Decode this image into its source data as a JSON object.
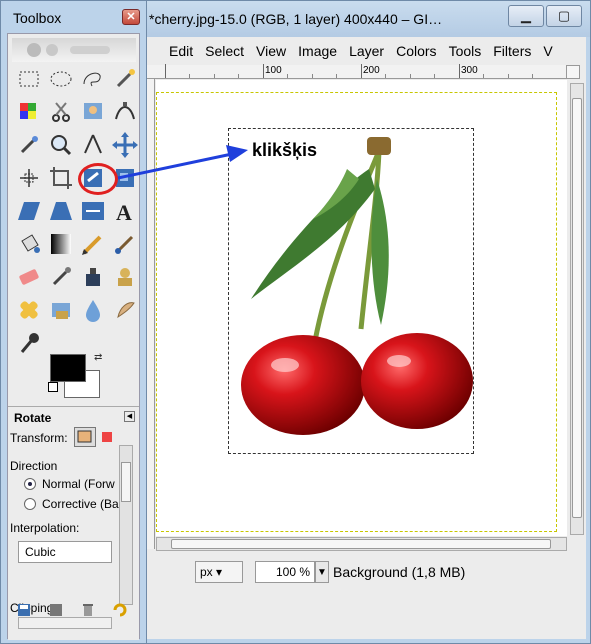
{
  "image_window": {
    "title": "*cherry.jpg-15.0 (RGB, 1 layer) 400x440 – GI…",
    "menu": [
      "Edit",
      "Select",
      "View",
      "Image",
      "Layer",
      "Colors",
      "Tools",
      "Filters",
      "V"
    ],
    "ruler_labels": [
      "100",
      "200",
      "300"
    ],
    "unit": "px",
    "zoom": "100 %",
    "status": "Background (1,8 MB)"
  },
  "toolbox": {
    "title": "Toolbox",
    "options": {
      "title": "Rotate",
      "transform_label": "Transform:",
      "direction_label": "Direction",
      "direction_options": [
        "Normal (Forw",
        "Corrective (Ba"
      ],
      "interpolation_label": "Interpolation:",
      "interpolation_value": "Cubic",
      "clipping_label": "Clipping:"
    },
    "tools": [
      "rect-select",
      "ellipse-select",
      "free-select",
      "fuzzy-select",
      "select-by-color",
      "scissors",
      "foreground-select",
      "paths",
      "color-picker",
      "zoom",
      "measure",
      "move",
      "align",
      "crop",
      "rotate",
      "scale",
      "shear",
      "perspective",
      "flip",
      "text",
      "bucket-fill",
      "blend",
      "pencil",
      "paintbrush",
      "eraser",
      "airbrush",
      "ink",
      "clone",
      "heal",
      "perspective-clone",
      "blur",
      "smudge",
      "dodge-burn"
    ],
    "highlight_color": "#e02020"
  },
  "annotation": {
    "label": "klikšķis",
    "arrow_color": "#1f3fdc"
  }
}
